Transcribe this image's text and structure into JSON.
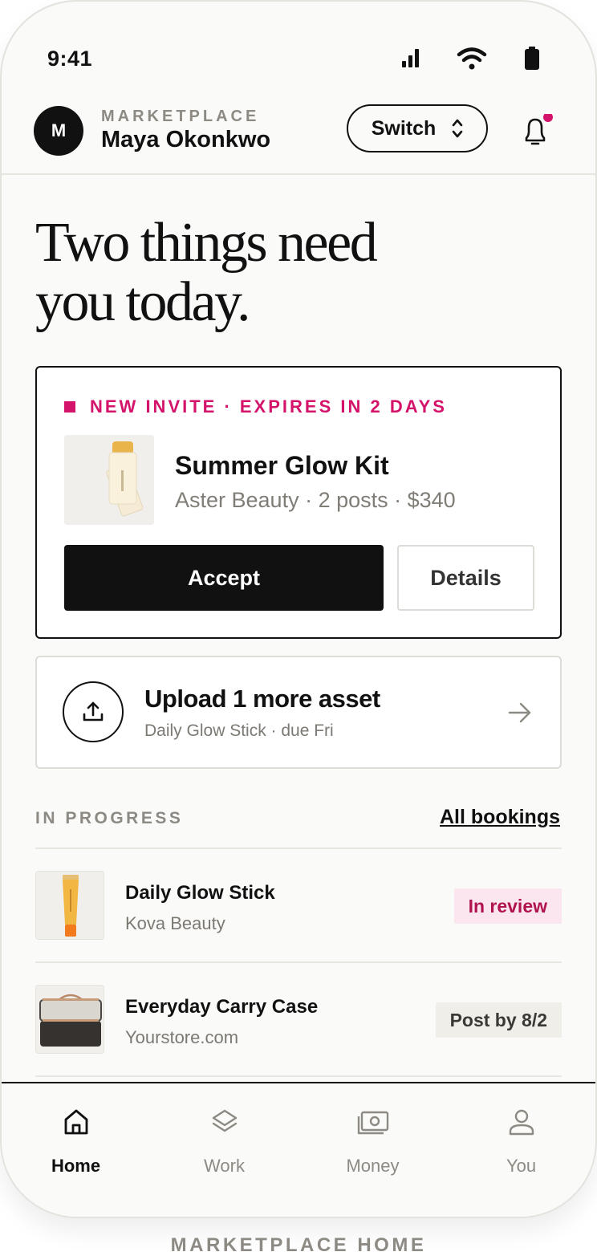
{
  "status_bar": {
    "time": "9:41",
    "icons": [
      "signal-icon",
      "wifi-icon",
      "battery-icon"
    ]
  },
  "header": {
    "avatar_initial": "M",
    "role_label": "MARKETPLACE",
    "user_name": "Maya Okonkwo",
    "switch_label": "Switch",
    "has_notification": true
  },
  "headline": {
    "line1": "Two things need",
    "line2": "you today."
  },
  "invite": {
    "tag": "NEW INVITE · EXPIRES IN 2 DAYS",
    "title": "Summer Glow Kit",
    "subtitle": "Aster Beauty · 2 posts · $340",
    "accept_label": "Accept",
    "details_label": "Details"
  },
  "upload_task": {
    "title": "Upload 1 more asset",
    "subtitle": "Daily Glow Stick · due Fri"
  },
  "in_progress": {
    "section_label": "IN PROGRESS",
    "link_label": "All bookings",
    "items": [
      {
        "title": "Daily Glow Stick",
        "brand": "Kova Beauty",
        "status": "In review"
      },
      {
        "title": "Everyday Carry Case",
        "brand": "Yourstore.com",
        "status": "Post by 8/2"
      }
    ]
  },
  "tab_bar": {
    "tabs": [
      {
        "label": "Home",
        "icon": "home-icon",
        "active": true
      },
      {
        "label": "Work",
        "icon": "layers-icon",
        "active": false
      },
      {
        "label": "Money",
        "icon": "cash-icon",
        "active": false
      },
      {
        "label": "You",
        "icon": "user-icon",
        "active": false
      }
    ]
  },
  "caption": "MARKETPLACE HOME",
  "colors": {
    "accent": "#d4136b",
    "ink": "#111111",
    "muted": "#8d8a84",
    "background": "#fafaf9"
  }
}
